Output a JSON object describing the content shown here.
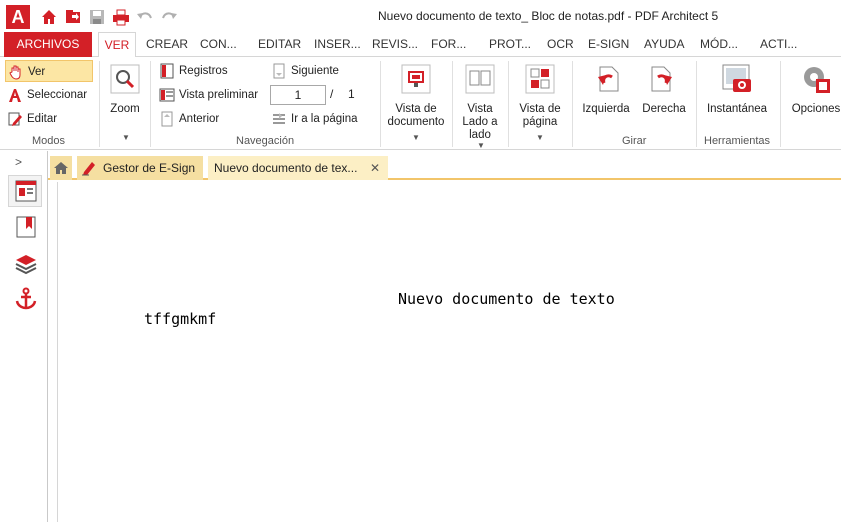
{
  "window": {
    "title": "Nuevo documento de texto_ Bloc de notas.pdf   -   PDF Architect 5"
  },
  "ribbon_tabs": [
    {
      "label": "ARCHIVOS"
    },
    {
      "label": "VER"
    },
    {
      "label": "CREAR"
    },
    {
      "label": "CON..."
    },
    {
      "label": "EDITAR"
    },
    {
      "label": "INSER..."
    },
    {
      "label": "REVIS..."
    },
    {
      "label": "FOR..."
    },
    {
      "label": "PROT..."
    },
    {
      "label": "OCR"
    },
    {
      "label": "E-SIGN"
    },
    {
      "label": "AYUDA"
    },
    {
      "label": "MÓD..."
    },
    {
      "label": "ACTI..."
    }
  ],
  "active_tab": "VER",
  "ribbon": {
    "modos": {
      "label": "Modos",
      "ver": "Ver",
      "seleccionar": "Seleccionar",
      "editar": "Editar"
    },
    "zoom": "Zoom",
    "navegacion": {
      "label": "Navegación",
      "registros": "Registros",
      "vista_preliminar": "Vista preliminar",
      "anterior": "Anterior",
      "siguiente": "Siguiente",
      "ir_pagina": "Ir a la página",
      "current_page": "1",
      "slash": "/",
      "total_pages": "1"
    },
    "vista_documento": "Vista de documento",
    "vista_lado": "Vista Lado a lado",
    "vista_pagina": "Vista de página",
    "girar": {
      "label": "Girar",
      "izquierda": "Izquierda",
      "derecha": "Derecha"
    },
    "herramientas": {
      "label": "Herramientas",
      "instantanea": "Instantánea"
    },
    "opciones": "Opciones"
  },
  "doc_tabs": [
    {
      "label": "Gestor de E-Sign"
    },
    {
      "label": "Nuevo documento de tex..."
    }
  ],
  "document": {
    "title": "Nuevo documento de texto",
    "body": "tffgmkmf"
  },
  "colors": {
    "accent": "#d32027",
    "tab_highlight": "#fce6a4"
  }
}
